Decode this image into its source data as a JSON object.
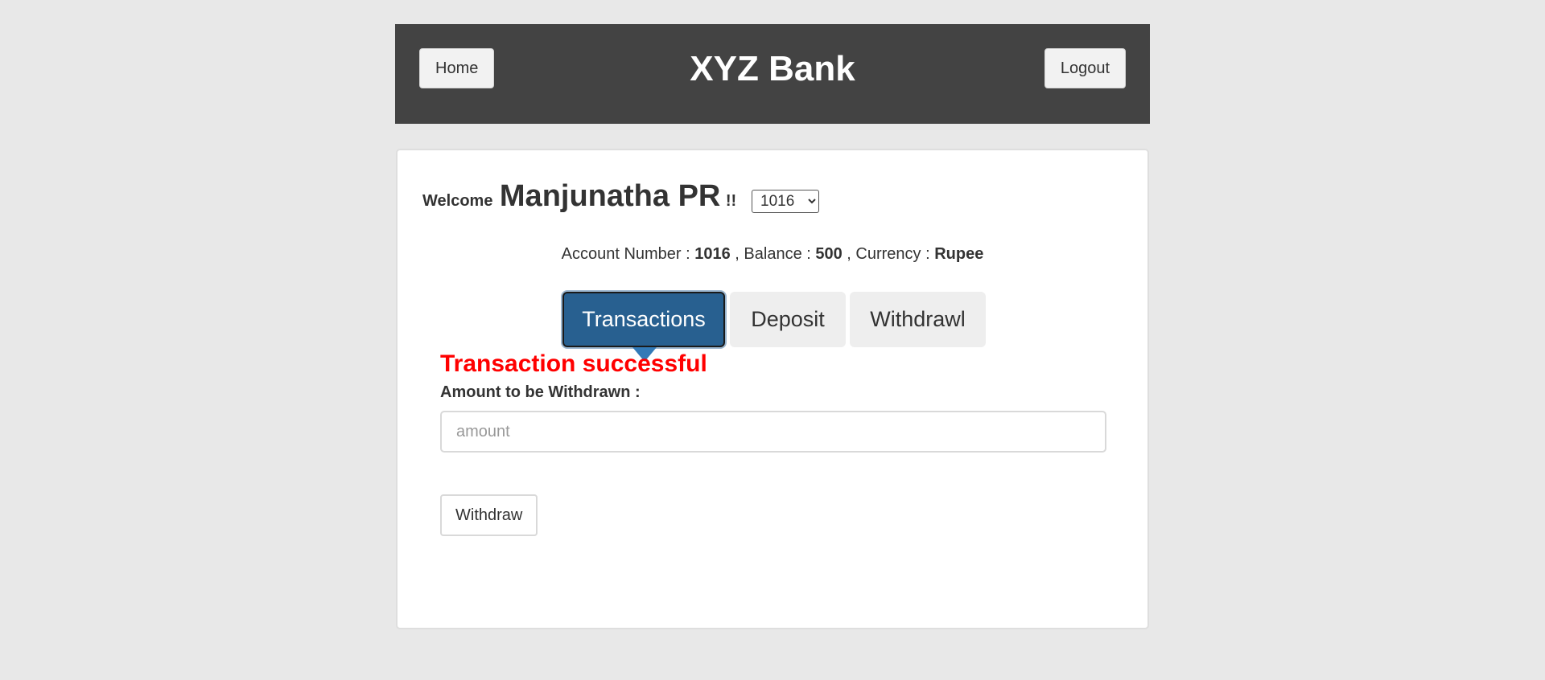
{
  "header": {
    "home_label": "Home",
    "title": "XYZ Bank",
    "logout_label": "Logout"
  },
  "welcome": {
    "label": "Welcome",
    "customer_name": "Manjunatha PR",
    "suffix": "!!",
    "selected_account": "1016"
  },
  "account_info": {
    "account_number_label": "Account Number : ",
    "account_number": "1016",
    "balance_label": " , Balance : ",
    "balance": "500",
    "currency_label": " , Currency : ",
    "currency": "Rupee"
  },
  "tabs": {
    "transactions_label": "Transactions",
    "deposit_label": "Deposit",
    "withdrawl_label": "Withdrawl",
    "active_tab": "Transactions"
  },
  "withdraw_form": {
    "message": "Transaction successful",
    "amount_label": "Amount to be Withdrawn :",
    "amount_placeholder": "amount",
    "amount_value": "",
    "submit_label": "Withdraw"
  },
  "colors": {
    "header_background": "#434343",
    "page_background": "#e8e8e8",
    "active_tab": "#286090",
    "message": "#ff0000"
  }
}
